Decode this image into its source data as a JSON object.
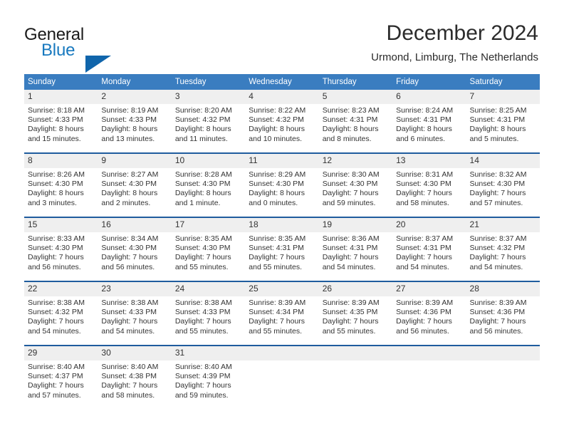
{
  "brand": {
    "name_top": "General",
    "name_bottom": "Blue",
    "triangle_icon": "blue-triangle-logo",
    "accent_color": "#1065ab"
  },
  "header": {
    "title": "December 2024",
    "location": "Urmond, Limburg, The Netherlands"
  },
  "theme": {
    "header_row_bg": "#3a7dc0",
    "row_divider": "#1f5c9e",
    "daynum_bg": "#efefef",
    "text": "#333333"
  },
  "weekdays": [
    "Sunday",
    "Monday",
    "Tuesday",
    "Wednesday",
    "Thursday",
    "Friday",
    "Saturday"
  ],
  "weeks": [
    [
      {
        "day": "1",
        "sunrise": "Sunrise: 8:18 AM",
        "sunset": "Sunset: 4:33 PM",
        "daylight1": "Daylight: 8 hours",
        "daylight2": "and 15 minutes."
      },
      {
        "day": "2",
        "sunrise": "Sunrise: 8:19 AM",
        "sunset": "Sunset: 4:33 PM",
        "daylight1": "Daylight: 8 hours",
        "daylight2": "and 13 minutes."
      },
      {
        "day": "3",
        "sunrise": "Sunrise: 8:20 AM",
        "sunset": "Sunset: 4:32 PM",
        "daylight1": "Daylight: 8 hours",
        "daylight2": "and 11 minutes."
      },
      {
        "day": "4",
        "sunrise": "Sunrise: 8:22 AM",
        "sunset": "Sunset: 4:32 PM",
        "daylight1": "Daylight: 8 hours",
        "daylight2": "and 10 minutes."
      },
      {
        "day": "5",
        "sunrise": "Sunrise: 8:23 AM",
        "sunset": "Sunset: 4:31 PM",
        "daylight1": "Daylight: 8 hours",
        "daylight2": "and 8 minutes."
      },
      {
        "day": "6",
        "sunrise": "Sunrise: 8:24 AM",
        "sunset": "Sunset: 4:31 PM",
        "daylight1": "Daylight: 8 hours",
        "daylight2": "and 6 minutes."
      },
      {
        "day": "7",
        "sunrise": "Sunrise: 8:25 AM",
        "sunset": "Sunset: 4:31 PM",
        "daylight1": "Daylight: 8 hours",
        "daylight2": "and 5 minutes."
      }
    ],
    [
      {
        "day": "8",
        "sunrise": "Sunrise: 8:26 AM",
        "sunset": "Sunset: 4:30 PM",
        "daylight1": "Daylight: 8 hours",
        "daylight2": "and 3 minutes."
      },
      {
        "day": "9",
        "sunrise": "Sunrise: 8:27 AM",
        "sunset": "Sunset: 4:30 PM",
        "daylight1": "Daylight: 8 hours",
        "daylight2": "and 2 minutes."
      },
      {
        "day": "10",
        "sunrise": "Sunrise: 8:28 AM",
        "sunset": "Sunset: 4:30 PM",
        "daylight1": "Daylight: 8 hours",
        "daylight2": "and 1 minute."
      },
      {
        "day": "11",
        "sunrise": "Sunrise: 8:29 AM",
        "sunset": "Sunset: 4:30 PM",
        "daylight1": "Daylight: 8 hours",
        "daylight2": "and 0 minutes."
      },
      {
        "day": "12",
        "sunrise": "Sunrise: 8:30 AM",
        "sunset": "Sunset: 4:30 PM",
        "daylight1": "Daylight: 7 hours",
        "daylight2": "and 59 minutes."
      },
      {
        "day": "13",
        "sunrise": "Sunrise: 8:31 AM",
        "sunset": "Sunset: 4:30 PM",
        "daylight1": "Daylight: 7 hours",
        "daylight2": "and 58 minutes."
      },
      {
        "day": "14",
        "sunrise": "Sunrise: 8:32 AM",
        "sunset": "Sunset: 4:30 PM",
        "daylight1": "Daylight: 7 hours",
        "daylight2": "and 57 minutes."
      }
    ],
    [
      {
        "day": "15",
        "sunrise": "Sunrise: 8:33 AM",
        "sunset": "Sunset: 4:30 PM",
        "daylight1": "Daylight: 7 hours",
        "daylight2": "and 56 minutes."
      },
      {
        "day": "16",
        "sunrise": "Sunrise: 8:34 AM",
        "sunset": "Sunset: 4:30 PM",
        "daylight1": "Daylight: 7 hours",
        "daylight2": "and 56 minutes."
      },
      {
        "day": "17",
        "sunrise": "Sunrise: 8:35 AM",
        "sunset": "Sunset: 4:30 PM",
        "daylight1": "Daylight: 7 hours",
        "daylight2": "and 55 minutes."
      },
      {
        "day": "18",
        "sunrise": "Sunrise: 8:35 AM",
        "sunset": "Sunset: 4:31 PM",
        "daylight1": "Daylight: 7 hours",
        "daylight2": "and 55 minutes."
      },
      {
        "day": "19",
        "sunrise": "Sunrise: 8:36 AM",
        "sunset": "Sunset: 4:31 PM",
        "daylight1": "Daylight: 7 hours",
        "daylight2": "and 54 minutes."
      },
      {
        "day": "20",
        "sunrise": "Sunrise: 8:37 AM",
        "sunset": "Sunset: 4:31 PM",
        "daylight1": "Daylight: 7 hours",
        "daylight2": "and 54 minutes."
      },
      {
        "day": "21",
        "sunrise": "Sunrise: 8:37 AM",
        "sunset": "Sunset: 4:32 PM",
        "daylight1": "Daylight: 7 hours",
        "daylight2": "and 54 minutes."
      }
    ],
    [
      {
        "day": "22",
        "sunrise": "Sunrise: 8:38 AM",
        "sunset": "Sunset: 4:32 PM",
        "daylight1": "Daylight: 7 hours",
        "daylight2": "and 54 minutes."
      },
      {
        "day": "23",
        "sunrise": "Sunrise: 8:38 AM",
        "sunset": "Sunset: 4:33 PM",
        "daylight1": "Daylight: 7 hours",
        "daylight2": "and 54 minutes."
      },
      {
        "day": "24",
        "sunrise": "Sunrise: 8:38 AM",
        "sunset": "Sunset: 4:33 PM",
        "daylight1": "Daylight: 7 hours",
        "daylight2": "and 55 minutes."
      },
      {
        "day": "25",
        "sunrise": "Sunrise: 8:39 AM",
        "sunset": "Sunset: 4:34 PM",
        "daylight1": "Daylight: 7 hours",
        "daylight2": "and 55 minutes."
      },
      {
        "day": "26",
        "sunrise": "Sunrise: 8:39 AM",
        "sunset": "Sunset: 4:35 PM",
        "daylight1": "Daylight: 7 hours",
        "daylight2": "and 55 minutes."
      },
      {
        "day": "27",
        "sunrise": "Sunrise: 8:39 AM",
        "sunset": "Sunset: 4:36 PM",
        "daylight1": "Daylight: 7 hours",
        "daylight2": "and 56 minutes."
      },
      {
        "day": "28",
        "sunrise": "Sunrise: 8:39 AM",
        "sunset": "Sunset: 4:36 PM",
        "daylight1": "Daylight: 7 hours",
        "daylight2": "and 56 minutes."
      }
    ],
    [
      {
        "day": "29",
        "sunrise": "Sunrise: 8:40 AM",
        "sunset": "Sunset: 4:37 PM",
        "daylight1": "Daylight: 7 hours",
        "daylight2": "and 57 minutes."
      },
      {
        "day": "30",
        "sunrise": "Sunrise: 8:40 AM",
        "sunset": "Sunset: 4:38 PM",
        "daylight1": "Daylight: 7 hours",
        "daylight2": "and 58 minutes."
      },
      {
        "day": "31",
        "sunrise": "Sunrise: 8:40 AM",
        "sunset": "Sunset: 4:39 PM",
        "daylight1": "Daylight: 7 hours",
        "daylight2": "and 59 minutes."
      },
      {
        "day": "",
        "sunrise": "",
        "sunset": "",
        "daylight1": "",
        "daylight2": ""
      },
      {
        "day": "",
        "sunrise": "",
        "sunset": "",
        "daylight1": "",
        "daylight2": ""
      },
      {
        "day": "",
        "sunrise": "",
        "sunset": "",
        "daylight1": "",
        "daylight2": ""
      },
      {
        "day": "",
        "sunrise": "",
        "sunset": "",
        "daylight1": "",
        "daylight2": ""
      }
    ]
  ]
}
